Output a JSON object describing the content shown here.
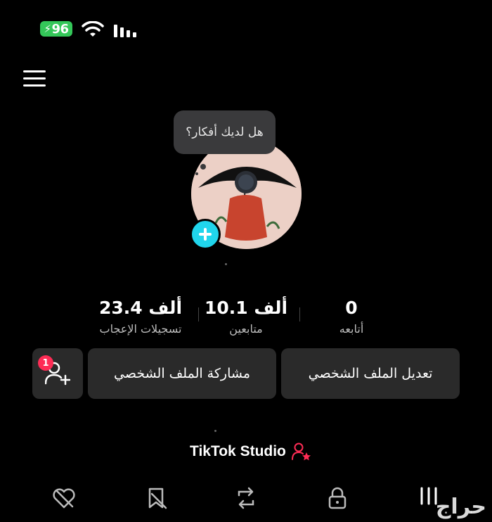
{
  "status_bar": {
    "battery": "96",
    "battery_color": "#34c759"
  },
  "profile": {
    "bubble_text": "هل لديك أفكار؟",
    "stats": {
      "following": {
        "value": "0",
        "label": "أتابعه"
      },
      "followers": {
        "value": "10.1 ألف",
        "label": "متابعين"
      },
      "likes": {
        "value": "23.4 ألف",
        "label": "تسجيلات الإعجاب"
      }
    },
    "buttons": {
      "edit_profile": "تعديل الملف الشخصي",
      "share_profile": "مشاركة الملف الشخصي",
      "friends_badge": "1"
    },
    "studio_label": "TikTok Studio"
  },
  "tabs": [
    {
      "icon": "heart-hidden-icon"
    },
    {
      "icon": "bookmark-hidden-icon"
    },
    {
      "icon": "repost-icon"
    },
    {
      "icon": "lock-icon"
    },
    {
      "icon": "grid-icon"
    }
  ],
  "watermark": "حراج",
  "colors": {
    "accent": "#fe2c55",
    "avatar_add": "#20d5ec",
    "button_bg": "#2a2a2a"
  }
}
